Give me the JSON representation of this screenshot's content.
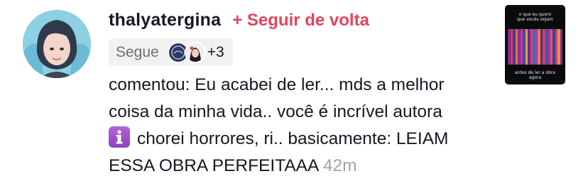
{
  "notification": {
    "username": "thalyatergina",
    "follow_back_label": "+ Seguir de volta",
    "follows_label": "Segue",
    "follows_extra_count": "+3",
    "comment_prefix": "comentou:",
    "comment_line1": "Eu acabei de ler... mds a melhor",
    "comment_line2": "coisa da minha vida.. você é incrível autora",
    "comment_line3": "chorei horrores, ri.. basicamente: LEIAM",
    "comment_line4": "ESSA OBRA PERFEITAAA",
    "time": "42m",
    "emoji": "information-emoji",
    "colors": {
      "follow_back": "#e2445c",
      "username": "#161823",
      "muted": "#a1a2a7"
    }
  },
  "thumbnail": {
    "top_text_line1": "o que eu quero",
    "top_text_line2": "que vocês vejam",
    "bottom_text_line1": "antes de ler a obra",
    "bottom_text_line2": "agora"
  }
}
